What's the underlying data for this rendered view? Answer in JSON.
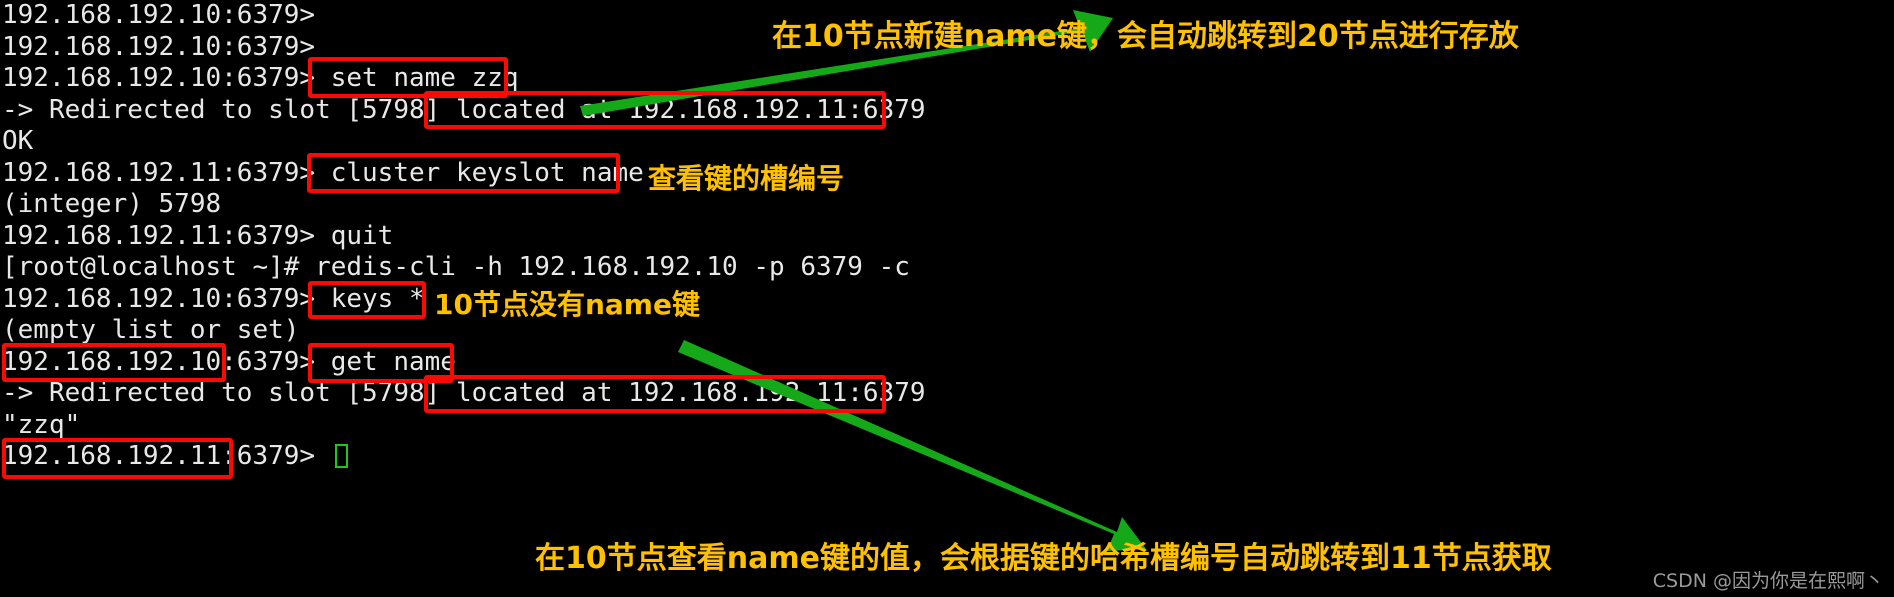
{
  "terminal": {
    "background_color": "#000000",
    "text_color": "#e8e8e8",
    "lines": [
      "192.168.192.10:6379>",
      "192.168.192.10:6379>",
      "192.168.192.10:6379> set name zzq",
      "-> Redirected to slot [5798] located at 192.168.192.11:6379",
      "OK",
      "192.168.192.11:6379> cluster keyslot name",
      "(integer) 5798",
      "192.168.192.11:6379> quit",
      "[root@localhost ~]# redis-cli -h 192.168.192.10 -p 6379 -c",
      "192.168.192.10:6379> keys *",
      "(empty list or set)",
      "192.168.192.10:6379> get name",
      "-> Redirected to slot [5798] located at 192.168.192.11:6379",
      "\"zzq\"",
      "192.168.192.11:6379> "
    ],
    "cursor": {
      "visible": true,
      "color": "#22c322",
      "style": "hollow-block"
    }
  },
  "annotations": {
    "highlight_color": "#fb0a05",
    "note_color": "#ffc000",
    "arrow_color": "#15a818",
    "notes": [
      {
        "id": "note-top",
        "text": "在10节点新建name键，会自动跳转到20节点进行存放"
      },
      {
        "id": "note-slot",
        "text": "查看键的槽编号"
      },
      {
        "id": "note-keys",
        "text": "10节点没有name键"
      },
      {
        "id": "note-bottom",
        "text": "在10节点查看name键的值，会根据键的哈希槽编号自动跳转到11节点获取"
      }
    ],
    "boxes": [
      {
        "id": "box-set-name-zzq",
        "label": "set name zzq"
      },
      {
        "id": "box-located-at-11-upper",
        "label": "located at 192.168.192.11:6379"
      },
      {
        "id": "box-cluster-keyslot",
        "label": "cluster keyslot name"
      },
      {
        "id": "box-keys-star",
        "label": "keys *"
      },
      {
        "id": "box-prompt-ip-10",
        "label": "192.168.192.10"
      },
      {
        "id": "box-get-name",
        "label": "get name"
      },
      {
        "id": "box-located-at-11-lower",
        "label": "located at 192.168.192.11:6379"
      },
      {
        "id": "box-prompt-ip-11",
        "label": "192.168.192.11:"
      }
    ],
    "arrows": [
      {
        "id": "arrow-top",
        "from": "located at 192.168.192.11:6379",
        "to": "在10节点新建name键，会自动跳转到20节点进行存放"
      },
      {
        "id": "arrow-bottom",
        "from": "get name",
        "to": "在10节点查看name键的值，会根据键的哈希槽编号自动跳转到11节点获取"
      }
    ]
  },
  "watermark": {
    "text": "CSDN @因为你是在熙啊丶"
  }
}
